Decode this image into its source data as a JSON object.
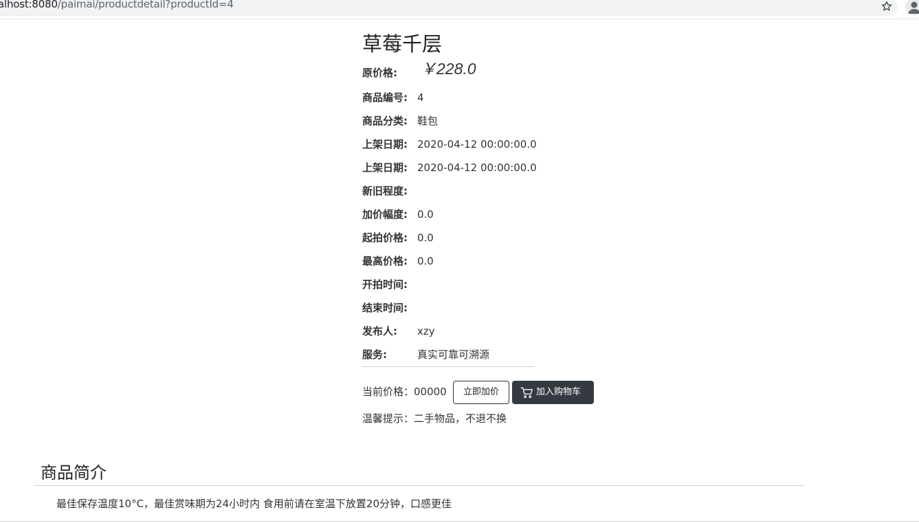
{
  "browser": {
    "url_host": "ocalhost:8080",
    "url_path": "/paimai/productdetail?productId=4"
  },
  "product": {
    "title": "草莓千层",
    "original_price_label": "原价格:",
    "original_price": "￥228.0",
    "fields": [
      {
        "label": "商品编号:",
        "value": "4"
      },
      {
        "label": "商品分类:",
        "value": "鞋包"
      },
      {
        "label": "上架日期:",
        "value": "2020-04-12 00:00:00.0"
      },
      {
        "label": "上架日期:",
        "value": "2020-04-12 00:00:00.0"
      },
      {
        "label": "新旧程度:",
        "value": ""
      },
      {
        "label": "加价幅度:",
        "value": "0.0"
      },
      {
        "label": "起拍价格:",
        "value": "0.0"
      },
      {
        "label": "最高价格:",
        "value": "0.0"
      },
      {
        "label": "开拍时间:",
        "value": ""
      },
      {
        "label": "结束时间:",
        "value": ""
      },
      {
        "label": "发布人:",
        "value": "xzy"
      },
      {
        "label": "服务:",
        "value": "真实可靠可溯源"
      }
    ],
    "current_price_text": "当前价格：00000",
    "bid_button_label": "立即加价",
    "cart_button_label": "加入购物车",
    "tip_text": "温馨提示：二手物品，不退不换"
  },
  "intro": {
    "heading": "商品简介",
    "text": "最佳保存温度10°C，最佳赏味期为24小时内 食用前请在室温下放置20分钟，口感更佳"
  },
  "colors": {
    "cart_button_bg": "#343a40",
    "url_bar_bg": "#f1f3f4"
  }
}
